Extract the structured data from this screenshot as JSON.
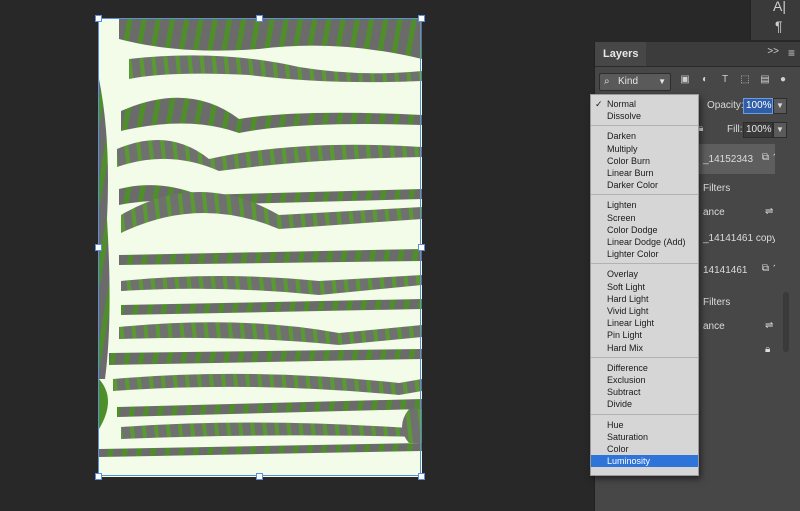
{
  "side_strip": {
    "char_icon_label": "A|",
    "paragraph_icon_label": "¶"
  },
  "layers_panel": {
    "tab_label": "Layers",
    "collapse_label": ">>",
    "menu_label": "≡",
    "filter": {
      "kind_label": "Kind"
    },
    "opacity": {
      "label": "Opacity:",
      "value": "100%"
    },
    "fill": {
      "label": "Fill:",
      "value": "100%"
    },
    "layers": [
      {
        "name": "_14152343"
      },
      {
        "name": "Filters"
      },
      {
        "name": "ance"
      },
      {
        "name": "_14141461 copy"
      },
      {
        "name": "14141461"
      },
      {
        "name": "Filters"
      },
      {
        "name": "ance"
      }
    ]
  },
  "blend_modes": {
    "selected": "Normal",
    "highlighted": "Luminosity",
    "groups": [
      [
        "Normal",
        "Dissolve"
      ],
      [
        "Darken",
        "Multiply",
        "Color Burn",
        "Linear Burn",
        "Darker Color"
      ],
      [
        "Lighten",
        "Screen",
        "Color Dodge",
        "Linear Dodge (Add)",
        "Lighter Color"
      ],
      [
        "Overlay",
        "Soft Light",
        "Hard Light",
        "Vivid Light",
        "Linear Light",
        "Pin Light",
        "Hard Mix"
      ],
      [
        "Difference",
        "Exclusion",
        "Subtract",
        "Divide"
      ],
      [
        "Hue",
        "Saturation",
        "Color",
        "Luminosity"
      ]
    ]
  },
  "colors": {
    "accent": "#2f75d9",
    "canvas_bg": "#282828",
    "panel_bg": "#474747",
    "art_gray": "#6b6b6b",
    "art_green": "#4f8f2a"
  }
}
